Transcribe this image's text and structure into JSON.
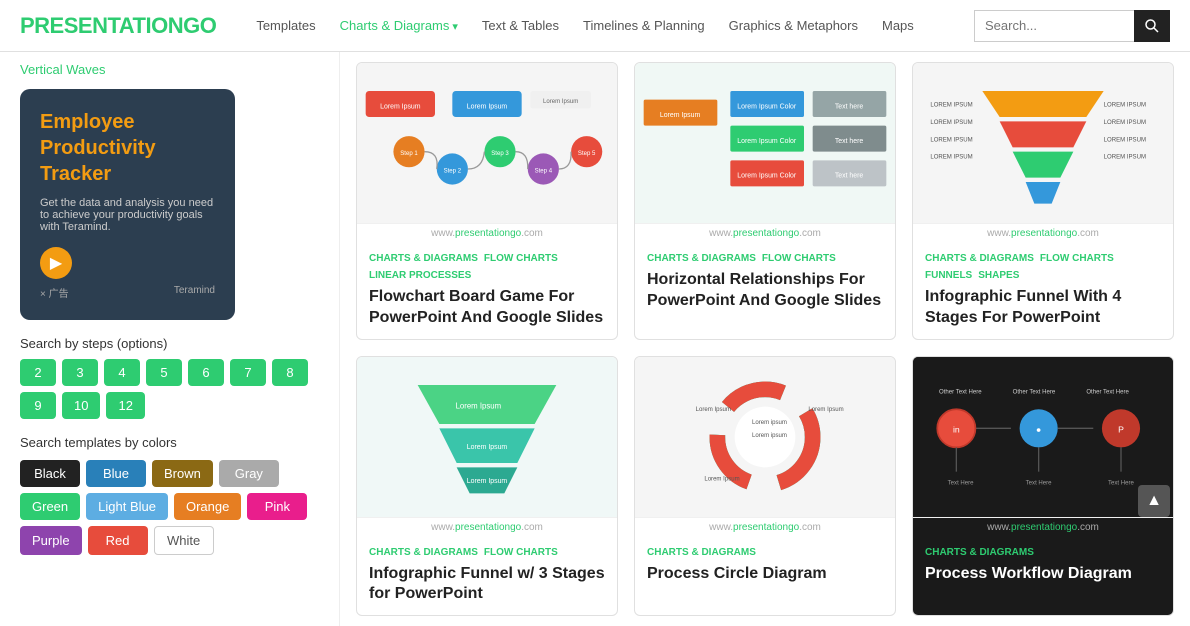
{
  "header": {
    "logo_text": "PRESENTATION",
    "logo_accent": "GO",
    "nav_items": [
      {
        "label": "Templates",
        "active": false,
        "dropdown": false
      },
      {
        "label": "Charts & Diagrams",
        "active": true,
        "dropdown": true
      },
      {
        "label": "Text & Tables",
        "active": false,
        "dropdown": false
      },
      {
        "label": "Timelines & Planning",
        "active": false,
        "dropdown": false
      },
      {
        "label": "Graphics & Metaphors",
        "active": false,
        "dropdown": false
      },
      {
        "label": "Maps",
        "active": false,
        "dropdown": false
      }
    ],
    "search_placeholder": "Search..."
  },
  "sidebar": {
    "vertical_waves_label": "Vertical Waves",
    "ad": {
      "title": "Employee Productivity Tracker",
      "subtitle": "Get the data and analysis you need to achieve your productivity goals with Teramind.",
      "footer_label": "× 广告",
      "logo_label": "Teramind"
    },
    "steps_label": "Search by steps (options)",
    "steps": [
      "2",
      "3",
      "4",
      "5",
      "6",
      "7",
      "8",
      "9",
      "10",
      "12"
    ],
    "colors_label": "Search templates by colors",
    "colors": [
      {
        "label": "Black",
        "class": "color-black"
      },
      {
        "label": "Blue",
        "class": "color-blue"
      },
      {
        "label": "Brown",
        "class": "color-brown"
      },
      {
        "label": "Gray",
        "class": "color-gray"
      },
      {
        "label": "Green",
        "class": "color-green"
      },
      {
        "label": "Light Blue",
        "class": "color-lightblue"
      },
      {
        "label": "Orange",
        "class": "color-orange"
      },
      {
        "label": "Pink",
        "class": "color-pink"
      },
      {
        "label": "Purple",
        "class": "color-purple"
      },
      {
        "label": "Red",
        "class": "color-red"
      },
      {
        "label": "White",
        "class": "color-white"
      }
    ]
  },
  "cards": [
    {
      "source": "www.presentationgo.com",
      "tags": [
        "CHARTS & DIAGRAMS",
        "FLOW CHARTS",
        "LINEAR PROCESSES"
      ],
      "title": "Flowchart Board Game For PowerPoint And Google Slides",
      "bg": "#f5f5f5",
      "type": "flowchart"
    },
    {
      "source": "www.presentationgo.com",
      "tags": [
        "CHARTS & DIAGRAMS",
        "FLOW CHARTS"
      ],
      "title": "Horizontal Relationships For PowerPoint And Google Slides",
      "bg": "#f0f8f5",
      "type": "horizontal"
    },
    {
      "source": "www.presentationgo.com",
      "tags": [
        "CHARTS & DIAGRAMS",
        "FLOW CHARTS",
        "FUNNELS",
        "SHAPES"
      ],
      "title": "Infographic Funnel With 4 Stages For PowerPoint",
      "bg": "#f5f5f5",
      "type": "funnel4"
    },
    {
      "source": "www.presentationgo.com",
      "tags": [
        "CHARTS & DIAGRAMS",
        "FLOW CHARTS"
      ],
      "title": "Infographic Funnel w/ 3 Stages for PowerPoint",
      "bg": "#f0f8f7",
      "type": "funnel3"
    },
    {
      "source": "www.presentationgo.com",
      "tags": [
        "CHARTS & DIAGRAMS"
      ],
      "title": "Process Circle Diagram",
      "bg": "#f5f5f5",
      "type": "circle"
    },
    {
      "source": "www.presentationgo.com",
      "tags": [
        "CHARTS & DIAGRAMS"
      ],
      "title": "Process Workflow Diagram",
      "bg": "#1a1a1a",
      "type": "workflow",
      "dark": true
    }
  ]
}
